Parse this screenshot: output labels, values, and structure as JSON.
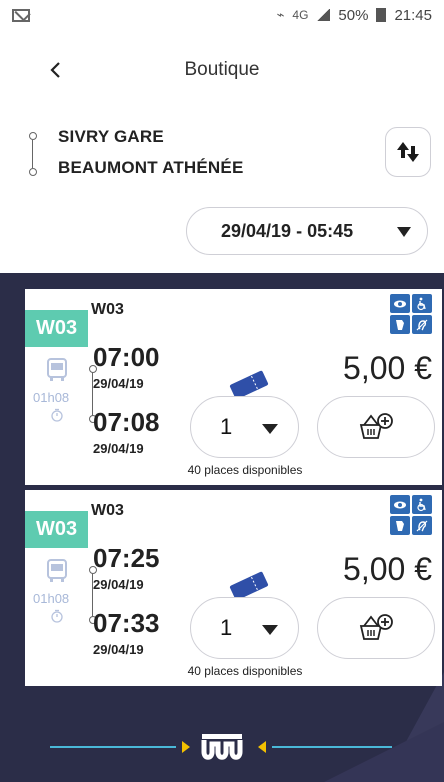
{
  "status_bar": {
    "network": "4G",
    "battery": "50%",
    "time": "21:45"
  },
  "header": {
    "title": "Boutique"
  },
  "route": {
    "from": "SIVRY GARE",
    "to": "BEAUMONT ATHÉNÉE"
  },
  "date_select": {
    "value": "29/04/19 - 05:45"
  },
  "colors": {
    "accent_teal": "#5ecbb0",
    "dark_bg": "#2b2d48",
    "ticket_blue": "#2f4fa8",
    "access_blue": "#2f6ab3",
    "logo_line": "#4ab8d8",
    "logo_arrow": "#f2c000"
  },
  "trips": [
    {
      "badge": "W03",
      "line_name": "W03",
      "departure_time": "07:00",
      "departure_date": "29/04/19",
      "arrival_time": "07:08",
      "arrival_date": "29/04/19",
      "duration": "01h08",
      "price": "5,00 €",
      "quantity": "1",
      "places": "40 places disponibles"
    },
    {
      "badge": "W03",
      "line_name": "W03",
      "departure_time": "07:25",
      "departure_date": "29/04/19",
      "arrival_time": "07:33",
      "arrival_date": "29/04/19",
      "duration": "01h08",
      "price": "5,00 €",
      "quantity": "1",
      "places": "40 places disponibles"
    }
  ],
  "icons": {
    "back": "chevron-left-icon",
    "swap": "swap-vertical-icon",
    "bus": "bus-icon",
    "timer": "timer-icon",
    "ticket": "ticket-icon",
    "add_to_basket": "basket-plus-icon",
    "accessibility": [
      "eye-icon",
      "wheelchair-icon",
      "audio-icon",
      "hearing-icon"
    ],
    "logo": "w-logo-icon"
  }
}
